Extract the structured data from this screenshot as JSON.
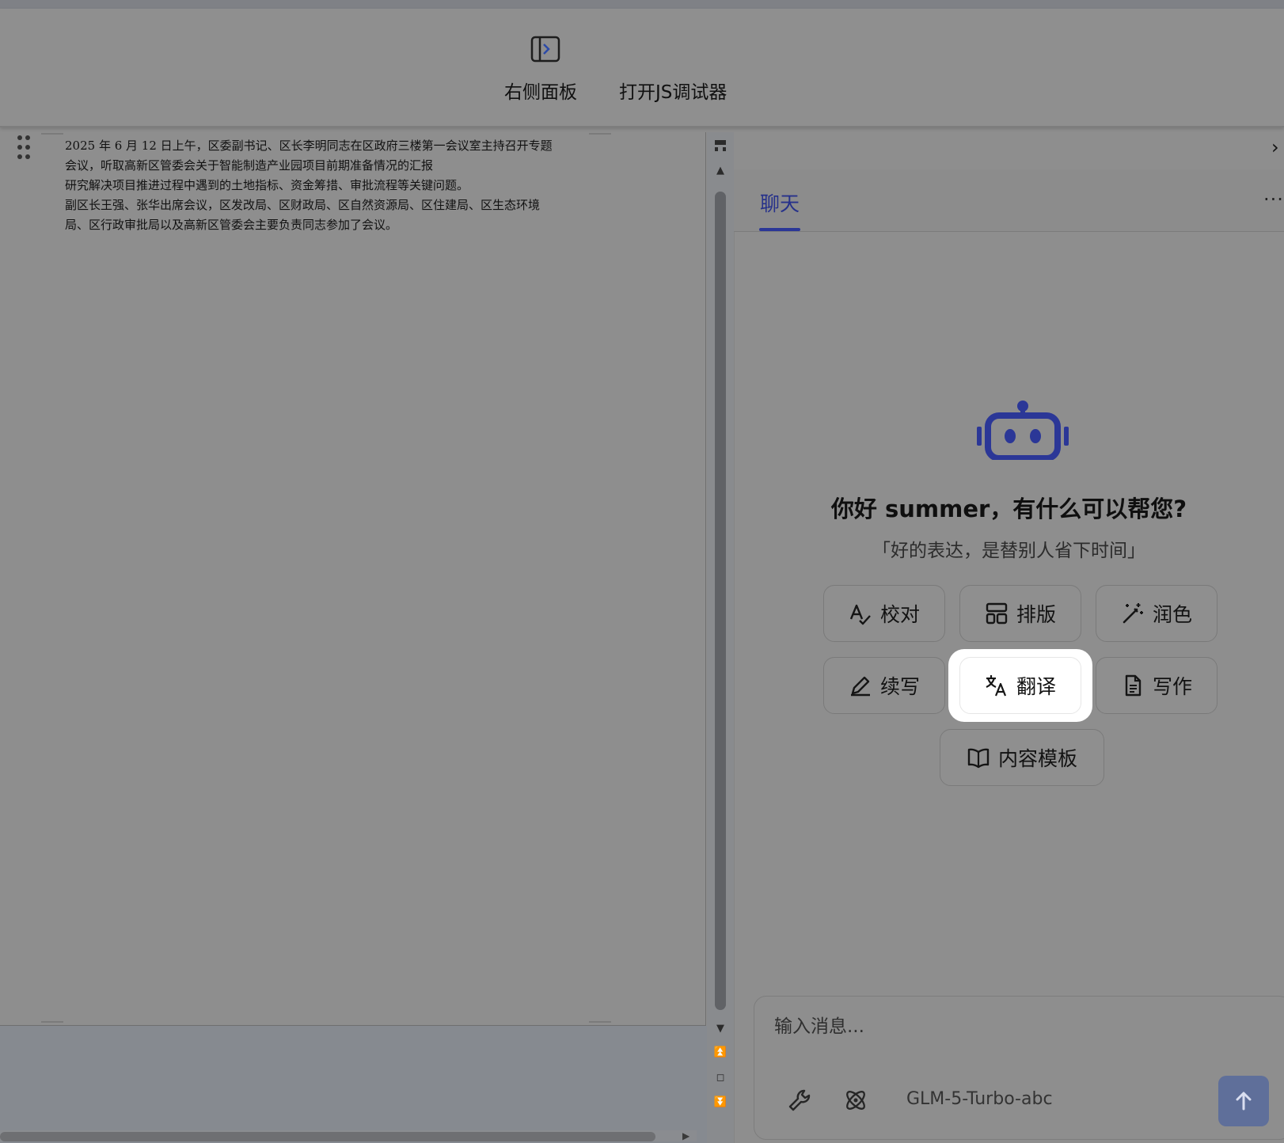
{
  "toolbar": {
    "right_panel_label": "右侧面板",
    "js_debugger_label": "打开JS调试器",
    "right_panel_icon": "panel-right-icon"
  },
  "document": {
    "lines": [
      "2025 年 6 月 12 日上午，区委副书记、区长李明同志在区政府三楼第一会议室主持召开专题",
      "会议，听取高新区管委会关于智能制造产业园项目前期准备情况的汇报",
      "研究解决项目推进过程中遇到的土地指标、资金筹措、审批流程等关键问题。",
      "副区长王强、张华出席会议，区发改局、区财政局、区自然资源局、区住建局、区生态环境",
      "局、区行政审批局以及高新区管委会主要负责同志参加了会议。"
    ]
  },
  "panel": {
    "tab_chat": "聊天",
    "close_glyph": "›",
    "more_glyph": "···",
    "greeting": "你好 summer，有什么可以帮您?",
    "tagline": "「好的表达，是替别人省下时间」",
    "accent_color": "#2b3797",
    "actions": [
      {
        "label": "校对",
        "icon": "spell-check-icon"
      },
      {
        "label": "排版",
        "icon": "layout-icon"
      },
      {
        "label": "润色",
        "icon": "magic-wand-icon"
      },
      {
        "label": "续写",
        "icon": "pencil-icon"
      },
      {
        "label": "翻译",
        "icon": "translate-icon",
        "active": true
      },
      {
        "label": "写作",
        "icon": "document-icon"
      },
      {
        "label": "内容模板",
        "icon": "book-icon"
      }
    ],
    "composer": {
      "placeholder": "输入消息...",
      "model": "GLM-5-Turbo-abc"
    }
  }
}
